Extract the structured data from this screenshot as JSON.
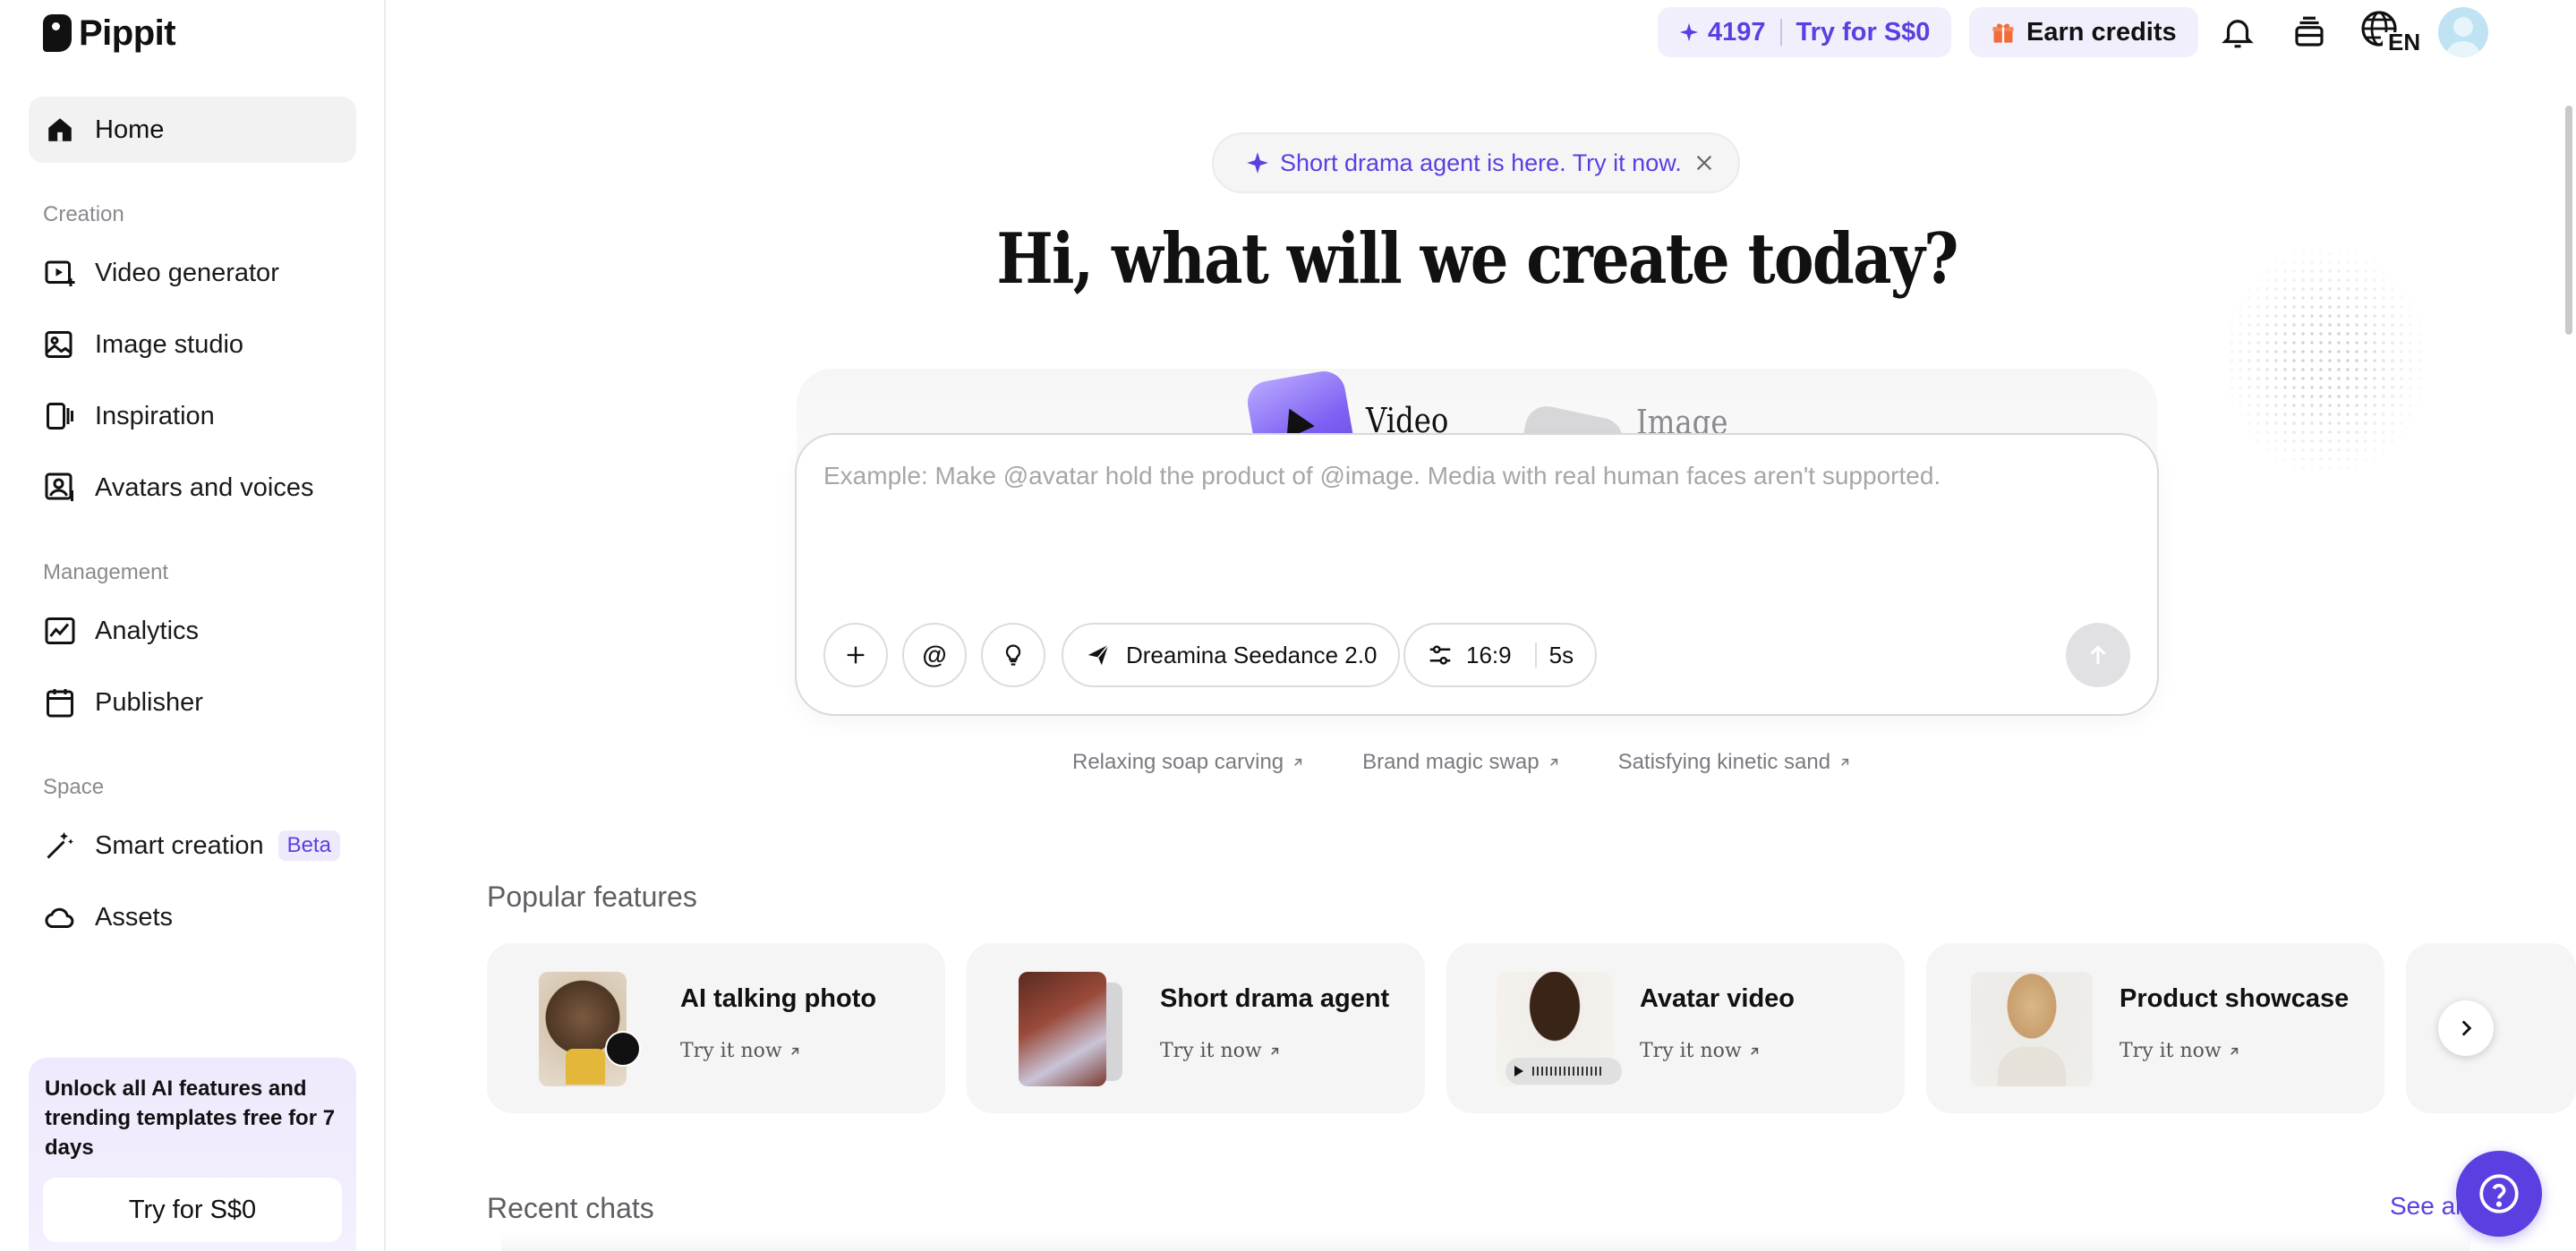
{
  "app": {
    "name": "Pippit"
  },
  "sidebar": {
    "home_label": "Home",
    "sections": {
      "creation": "Creation",
      "management": "Management",
      "space": "Space"
    },
    "items": {
      "video_generator": "Video generator",
      "image_studio": "Image studio",
      "inspiration": "Inspiration",
      "avatars_voices": "Avatars and voices",
      "analytics": "Analytics",
      "publisher": "Publisher",
      "smart_creation": "Smart creation",
      "smart_creation_badge": "Beta",
      "assets": "Assets"
    },
    "promo": {
      "text": "Unlock all AI features and trending templates free for 7 days",
      "button": "Try for S$0"
    }
  },
  "header": {
    "credits": "4197",
    "credits_try": "Try for S$0",
    "earn_credits": "Earn credits",
    "language": "EN",
    "accent_color": "#5b3fe0"
  },
  "hero": {
    "banner": "Short drama agent is here. Try it now.",
    "headline": "Hi, what will we create today?",
    "tabs": {
      "video": "Video",
      "image": "Image"
    },
    "prompt_placeholder": "Example: Make @avatar hold the product of @image. Media with real human faces aren't supported.",
    "model": "Dreamina Seedance 2.0",
    "ratio": "16:9",
    "duration": "5s",
    "suggestions": [
      "Relaxing soap carving",
      "Brand magic swap",
      "Satisfying kinetic sand"
    ]
  },
  "popular": {
    "title": "Popular features",
    "try_label": "Try it now",
    "cards": [
      {
        "title": "AI talking photo"
      },
      {
        "title": "Short drama agent"
      },
      {
        "title": "Avatar video"
      },
      {
        "title": "Product showcase"
      }
    ]
  },
  "recent": {
    "title": "Recent chats",
    "see_all": "See all"
  }
}
